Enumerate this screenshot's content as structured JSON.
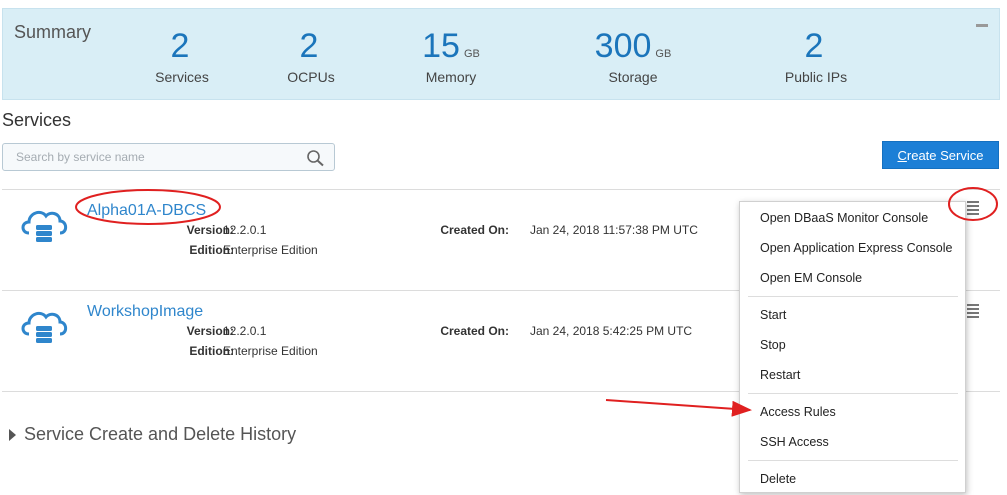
{
  "summary": {
    "title": "Summary",
    "metrics": [
      {
        "value": "2",
        "unit": "",
        "label": "Services"
      },
      {
        "value": "2",
        "unit": "",
        "label": "OCPUs"
      },
      {
        "value": "15",
        "unit": "GB",
        "label": "Memory"
      },
      {
        "value": "300",
        "unit": "GB",
        "label": "Storage"
      },
      {
        "value": "2",
        "unit": "",
        "label": "Public IPs"
      }
    ]
  },
  "services": {
    "title": "Services",
    "search_placeholder": "Search by service name",
    "create_button": {
      "first_letter": "C",
      "rest": "reate Service"
    },
    "items": [
      {
        "name": "Alpha01A-DBCS",
        "version_label": "Version:",
        "version": "12.2.0.1",
        "edition_label": "Edition:",
        "edition": "Enterprise Edition",
        "created_label": "Created On:",
        "created": "Jan 24, 2018 11:57:38 PM UTC"
      },
      {
        "name": "WorkshopImage",
        "version_label": "Version:",
        "version": "12.2.0.1",
        "edition_label": "Edition:",
        "edition": "Enterprise Edition",
        "created_label": "Created On:",
        "created": "Jan 24, 2018 5:42:25 PM UTC"
      }
    ]
  },
  "history": {
    "label": "Service Create and Delete History"
  },
  "menu": {
    "items": [
      "Open DBaaS Monitor Console",
      "Open Application Express Console",
      "Open EM Console",
      "Start",
      "Stop",
      "Restart",
      "Access Rules",
      "SSH Access",
      "Delete"
    ]
  },
  "colors": {
    "accent": "#1c7fd6",
    "link": "#2f86cc",
    "summary_bg": "#d9eef6",
    "annotation": "#e02020"
  }
}
